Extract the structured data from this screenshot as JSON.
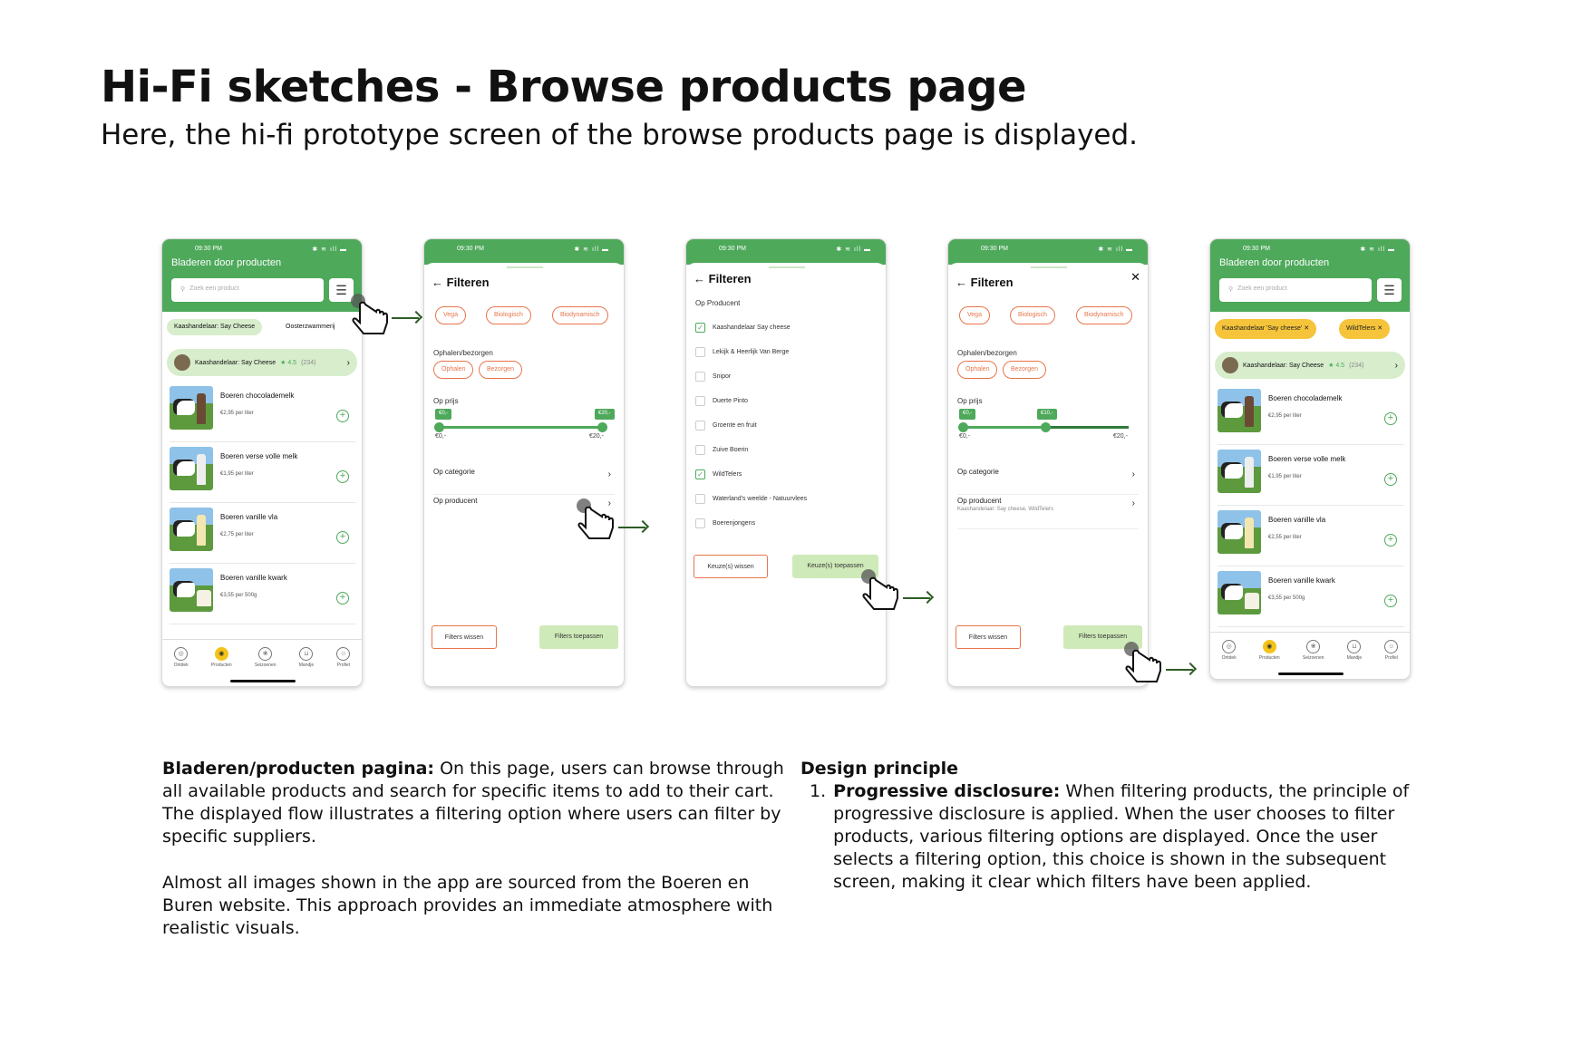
{
  "heading": "Hi-Fi sketches - Browse products page",
  "subheading": "Here, the hi-fi prototype screen of the browse products page is displayed.",
  "status_time": "09:30 PM",
  "browse": {
    "title": "Bladeren door producten",
    "search_placeholder": "Zoek een product",
    "chips": [
      "Kaashandelaar: Say Cheese",
      "Oosterzwammerij"
    ],
    "supplier": {
      "name": "Kaashandelaar: Say Cheese",
      "rating": "★ 4.5",
      "count": "(234)"
    },
    "products": [
      {
        "name": "Boeren chocolademelk",
        "price": "€2,95 per liter"
      },
      {
        "name": "Boeren verse volle melk",
        "price": "€1,95 per liter"
      },
      {
        "name": "Boeren vanille vla",
        "price": "€2,75 per liter"
      },
      {
        "name": "Boeren vanille kwark",
        "price": "€3,55 per 500g"
      }
    ],
    "nav": [
      "Ontdek",
      "Producten",
      "Seizoenen",
      "Mandje",
      "Profiel"
    ]
  },
  "filter": {
    "title": "Filteren",
    "tags": [
      "Vega",
      "Biologisch",
      "Biodynamisch"
    ],
    "pickup_label": "Ophalen/bezorgen",
    "pickup_options": [
      "Ophalen",
      "Bezorgen"
    ],
    "price_label": "Op prijs",
    "price_min": "€0,-",
    "price_max": "€20,-",
    "bubble_min": "€0,-",
    "bubble_max": "€20,-",
    "bubble_mid": "€10,-",
    "category_label": "Op categorie",
    "producer_label": "Op producent",
    "producer_selected": "Kaashandelaar: Say cheese, WildTelers",
    "clear": "Filters wissen",
    "apply": "Filters toepassen"
  },
  "producer": {
    "title": "Filteren",
    "section": "Op Producent",
    "options": [
      {
        "label": "Kaashandelaar Say cheese",
        "checked": "✓"
      },
      {
        "label": "Lekijk & Heerlijk Van Berge",
        "checked": ""
      },
      {
        "label": "Snipor",
        "checked": ""
      },
      {
        "label": "Duerte Pinto",
        "checked": ""
      },
      {
        "label": "Groente en fruit",
        "checked": ""
      },
      {
        "label": "Zuive Boerin",
        "checked": ""
      },
      {
        "label": "WildTelers",
        "checked": "✓"
      },
      {
        "label": "Waterland's weelde - Natuurvlees",
        "checked": ""
      },
      {
        "label": "Boerenjongens",
        "checked": ""
      }
    ],
    "clear": "Keuze(s) wissen",
    "apply": "Keuze(s) toepassen"
  },
  "result": {
    "chips": [
      "Kaashandelaar 'Say cheese'",
      "WildTelers"
    ],
    "products": [
      {
        "name": "Boeren chocolademelk",
        "price": "€2,95 per liter"
      },
      {
        "name": "Boeren verse volle melk",
        "price": "€1,95 per liter"
      },
      {
        "name": "Boeren vanille vla",
        "price": "€2,55 per liter"
      },
      {
        "name": "Boeren vanille kwark",
        "price": "€3,55 per 500g"
      }
    ]
  },
  "description": {
    "left_title": "Bladeren/producten pagina:",
    "left_p1": "On this page, users can browse through all available products and search for specific items to add to their cart. The displayed flow illustrates a filtering option where users can filter by specific suppliers.",
    "left_p2": "Almost all images shown in the app are sourced from the Boeren en Buren website. This approach provides an immediate atmosphere with realistic visuals.",
    "right_title": "Design principle",
    "right_item_title": "Progressive disclosure:",
    "right_item_text": "When filtering products, the principle of progressive disclosure is applied. When the user chooses to filter products, various filtering options are displayed. Once the user selects a filtering option, this choice is shown in the subsequent screen, making it clear which filters have been applied.",
    "right_item_num": "1."
  },
  "colors": {
    "green": "#4ea95b",
    "light_green": "#d7edcc",
    "orange": "#e8754b",
    "yellow": "#f2c318"
  }
}
